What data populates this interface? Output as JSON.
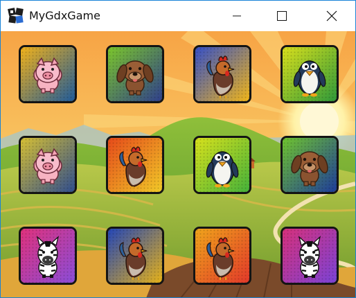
{
  "window": {
    "title": "MyGdxGame"
  },
  "controls": {
    "minimize": "minimize",
    "maximize": "maximize",
    "close": "close"
  },
  "board": {
    "columns": 4,
    "rows": 3,
    "cards": [
      {
        "animal": "pig",
        "icon": "pig-icon",
        "gradient": [
          "#f2b21a",
          "#1f5b9a"
        ]
      },
      {
        "animal": "dog",
        "icon": "dog-icon",
        "gradient": [
          "#7bc62b",
          "#2f3f8c"
        ]
      },
      {
        "animal": "rooster",
        "icon": "rooster-icon",
        "gradient": [
          "#3550c8",
          "#f0b51a"
        ]
      },
      {
        "animal": "penguin",
        "icon": "penguin-icon",
        "gradient": [
          "#d9df1c",
          "#2f9a3a"
        ]
      },
      {
        "animal": "pig",
        "icon": "pig-icon",
        "gradient": [
          "#d6c034",
          "#2f4d8e"
        ]
      },
      {
        "animal": "rooster",
        "icon": "rooster-icon",
        "gradient": [
          "#e64a1a",
          "#f1c928"
        ]
      },
      {
        "animal": "penguin",
        "icon": "penguin-icon",
        "gradient": [
          "#d8e11c",
          "#45b23a"
        ]
      },
      {
        "animal": "dog",
        "icon": "dog-icon",
        "gradient": [
          "#6fc42e",
          "#1e3c9a"
        ]
      },
      {
        "animal": "zebra",
        "icon": "zebra-icon",
        "gradient": [
          "#e0317c",
          "#8a4dd8"
        ]
      },
      {
        "animal": "rooster",
        "icon": "rooster-icon",
        "gradient": [
          "#2346b8",
          "#e6b219"
        ]
      },
      {
        "animal": "rooster",
        "icon": "rooster-icon",
        "gradient": [
          "#f0a41b",
          "#e2392a"
        ]
      },
      {
        "animal": "zebra",
        "icon": "zebra-icon",
        "gradient": [
          "#d7307b",
          "#7b43d6"
        ]
      }
    ]
  }
}
